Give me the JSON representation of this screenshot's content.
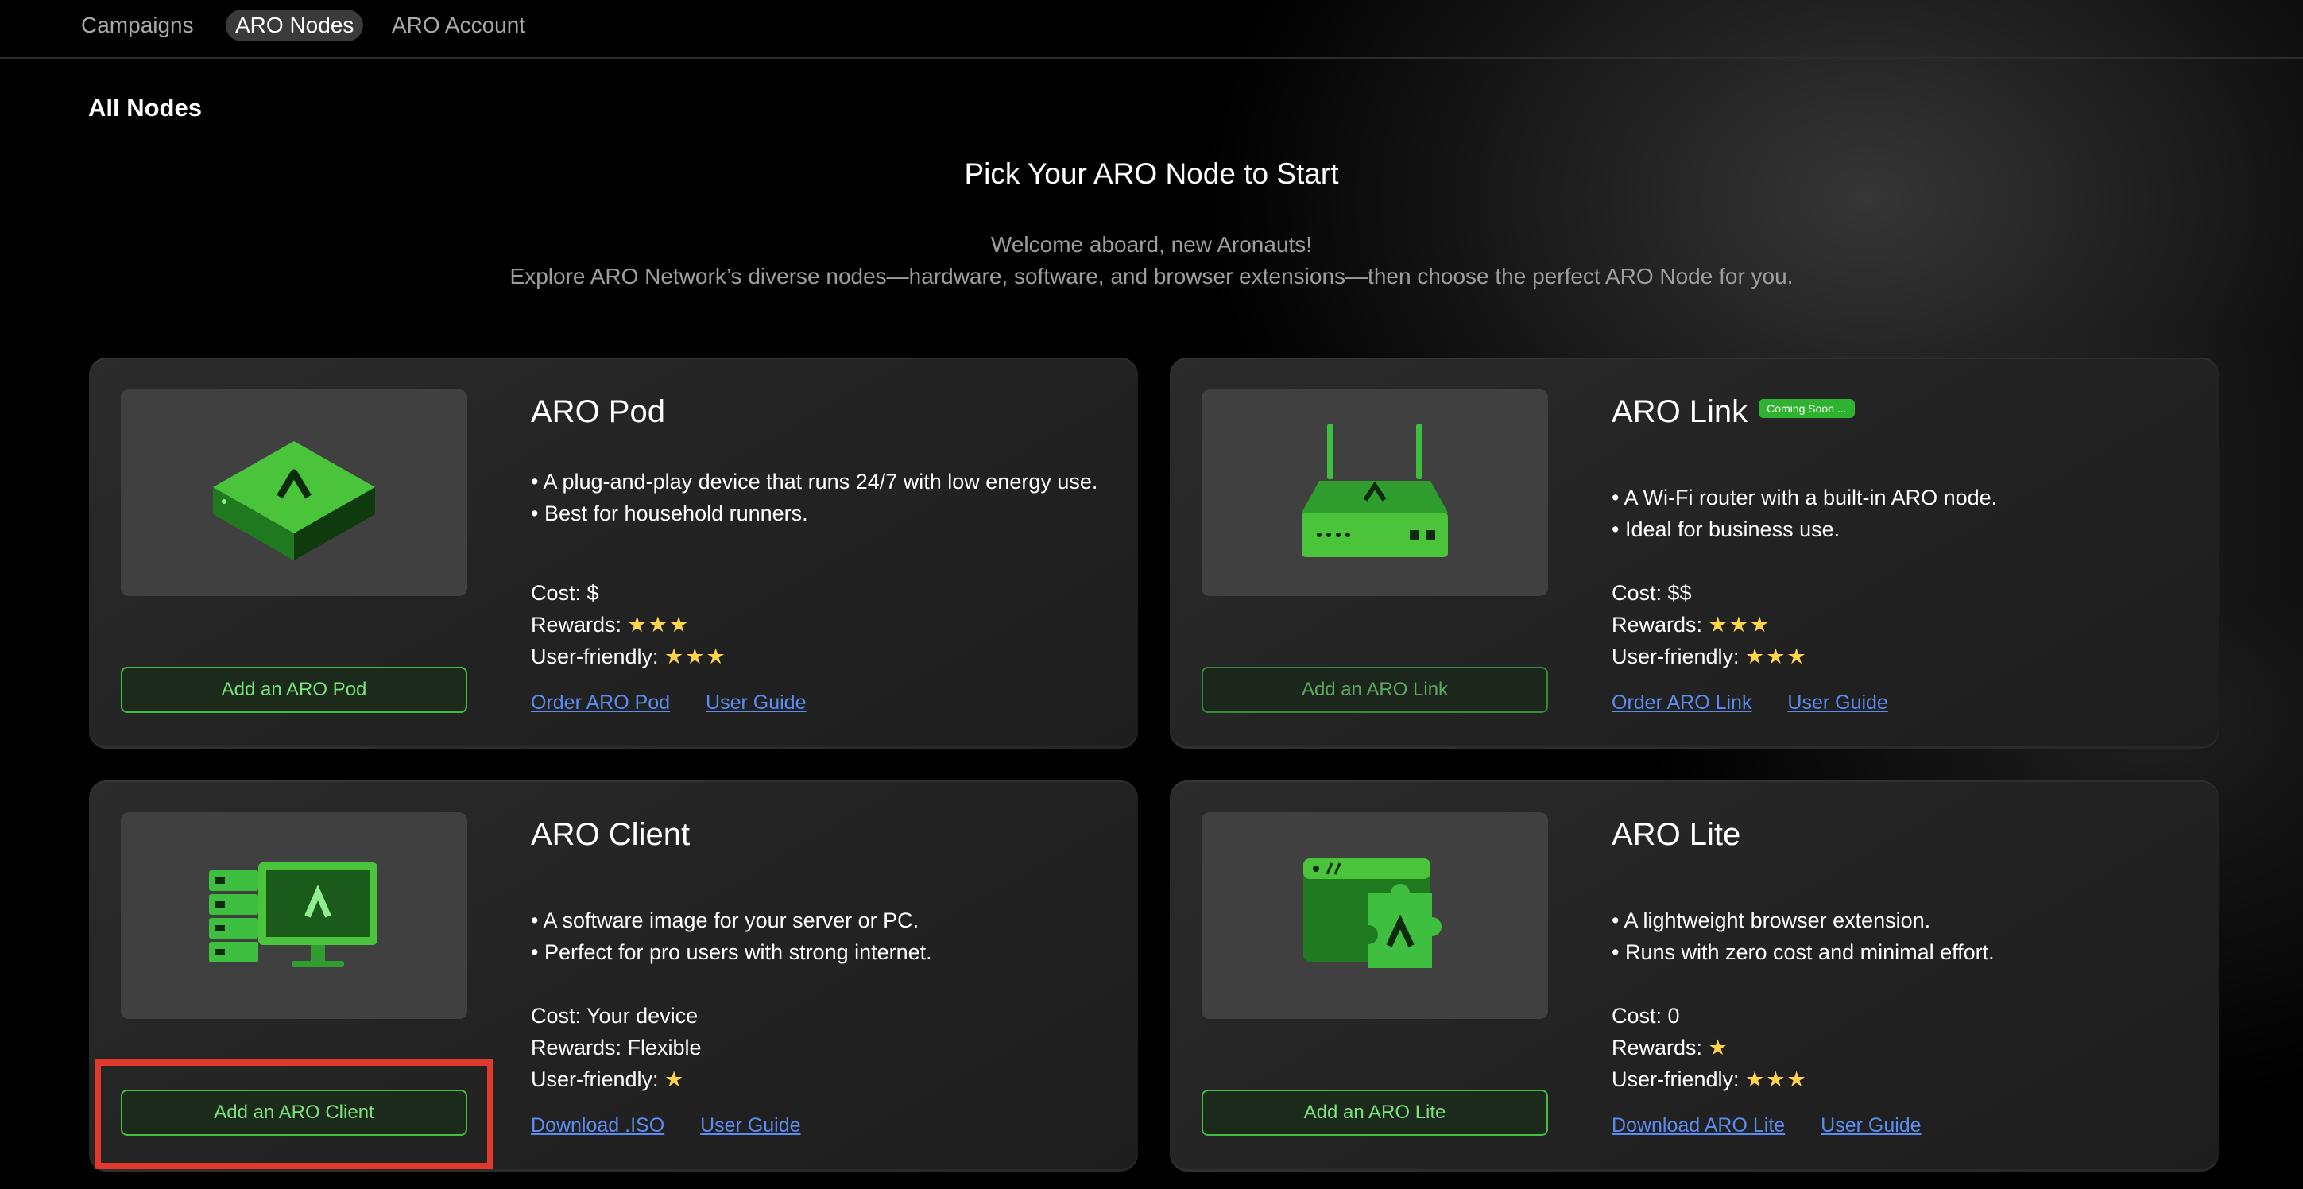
{
  "nav": {
    "tabs": [
      "Campaigns",
      "ARO Nodes",
      "ARO Account"
    ],
    "active_tab": "ARO Nodes"
  },
  "page": {
    "section_title": "All Nodes",
    "heading": "Pick Your ARO Node to Start",
    "welcome": "Welcome aboard, new Aronauts!",
    "subtitle": "Explore ARO Network’s diverse nodes—hardware, software, and browser extensions—then choose the perfect ARO Node for you."
  },
  "cards": {
    "pod": {
      "title": "ARO Pod",
      "bullet1": "• A plug-and-play device that runs 24/7 with low energy use.",
      "bullet2": "• Best for household runners.",
      "cost": "Cost: $",
      "rewards_label": "Rewards: ",
      "rewards_stars": "★★★",
      "friendly_label": "User-friendly: ",
      "friendly_stars": "★★★",
      "button": "Add an ARO Pod",
      "link1": "Order ARO Pod",
      "link2": "User Guide",
      "icon": "pod-device-icon"
    },
    "link": {
      "title": "ARO Link",
      "badge": "Coming Soon ...",
      "bullet1": "• A Wi-Fi router with a built-in ARO node.",
      "bullet2": "• Ideal for business use.",
      "cost": "Cost: $$",
      "rewards_label": "Rewards: ",
      "rewards_stars": "★★★",
      "friendly_label": "User-friendly: ",
      "friendly_stars": "★★★",
      "button": "Add an ARO Link",
      "link1": "Order ARO Link",
      "link2": "User Guide",
      "icon": "router-icon"
    },
    "client": {
      "title": "ARO Client",
      "bullet1": "• A software image for your server or PC.",
      "bullet2": "• Perfect for pro users with strong internet.",
      "cost": "Cost: Your device",
      "rewards": "Rewards: Flexible",
      "friendly_label": "User-friendly: ",
      "friendly_stars": "★",
      "button": "Add an ARO Client",
      "link1": "Download .ISO",
      "link2": "User Guide",
      "icon": "server-monitor-icon"
    },
    "lite": {
      "title": "ARO Lite",
      "bullet1": "• A lightweight browser extension.",
      "bullet2": "• Runs with zero cost and minimal effort.",
      "cost": "Cost: 0",
      "rewards_label": "Rewards: ",
      "rewards_stars": "★",
      "friendly_label": "User-friendly: ",
      "friendly_stars": "★★★",
      "button": "Add an ARO Lite",
      "link1": "Download ARO Lite",
      "link2": "User Guide",
      "icon": "browser-extension-icon"
    }
  },
  "colors": {
    "accent_green": "#3fbf3f",
    "link_blue": "#5b8cf0",
    "highlight_red": "#e1392b",
    "star_yellow": "#ffd44a"
  }
}
